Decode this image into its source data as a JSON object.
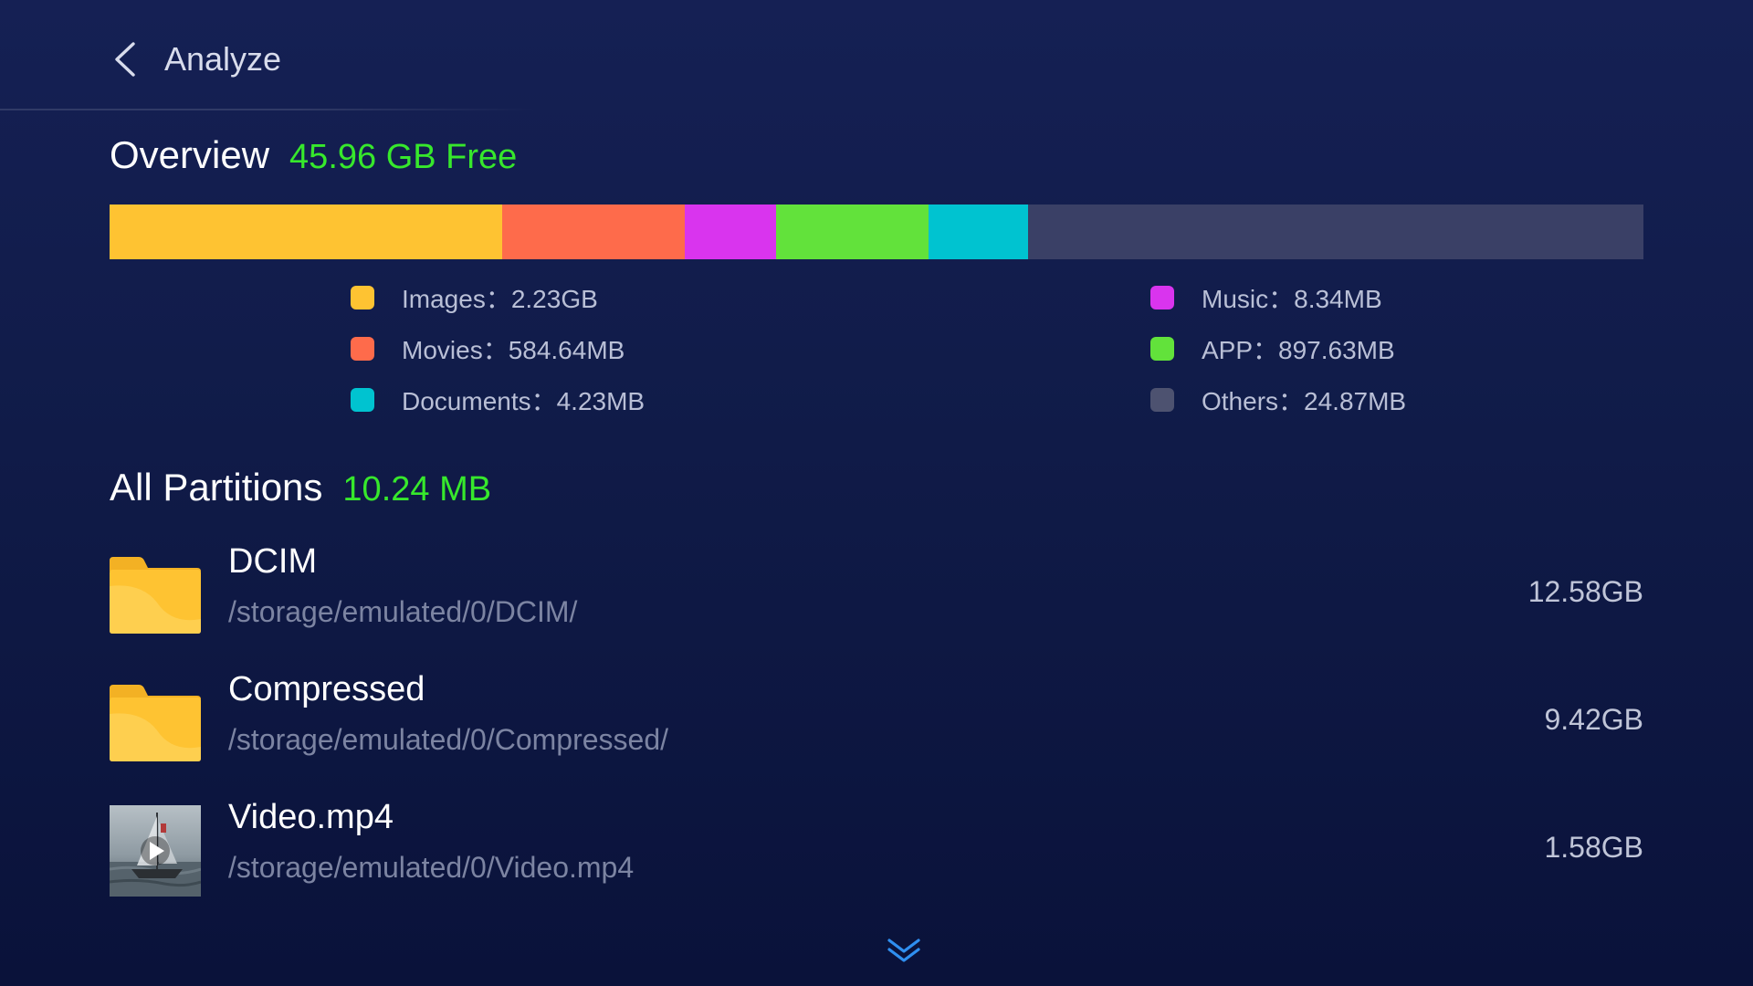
{
  "header": {
    "title": "Analyze",
    "back_icon": "chevron-left-icon"
  },
  "overview": {
    "title": "Overview",
    "free_label": "45.96 GB Free",
    "free_color": "#37e82c",
    "bar": {
      "segments": [
        {
          "name": "Images",
          "fraction": 0.256,
          "color": "#fec332"
        },
        {
          "name": "Movies",
          "fraction": 0.119,
          "color": "#fe6b4b"
        },
        {
          "name": "Music",
          "fraction": 0.0595,
          "color": "#d934ee"
        },
        {
          "name": "APP",
          "fraction": 0.0994,
          "color": "#62e23b"
        },
        {
          "name": "Documents",
          "fraction": 0.0649,
          "color": "#00c3d0"
        },
        {
          "name": "Others",
          "fraction": 0.4012,
          "color": "#3a4066"
        }
      ]
    },
    "legend": [
      {
        "label": "Images：2.23GB",
        "color": "#fec332"
      },
      {
        "label": "Movies：584.64MB",
        "color": "#fe6b4b"
      },
      {
        "label": "Documents：4.23MB",
        "color": "#00c3d0"
      },
      {
        "label": "Music：8.34MB",
        "color": "#d934ee"
      },
      {
        "label": "APP：897.63MB",
        "color": "#62e23b"
      },
      {
        "label": "Others：24.87MB",
        "color": "#4d5270"
      }
    ]
  },
  "partitions": {
    "title": "All Partitions",
    "size_label": "10.24 MB",
    "size_color": "#37e82c",
    "items": [
      {
        "name": "DCIM",
        "path": "/storage/emulated/0/DCIM/",
        "size": "12.58GB",
        "icon": "folder-icon"
      },
      {
        "name": "Compressed",
        "path": "/storage/emulated/0/Compressed/",
        "size": "9.42GB",
        "icon": "folder-icon"
      },
      {
        "name": "Video.mp4",
        "path": "/storage/emulated/0/Video.mp4",
        "size": "1.58GB",
        "icon": "video-thumbnail"
      }
    ]
  },
  "scroll_indicator": {
    "icon": "double-chevron-down-icon",
    "color": "#2f8ff0"
  }
}
